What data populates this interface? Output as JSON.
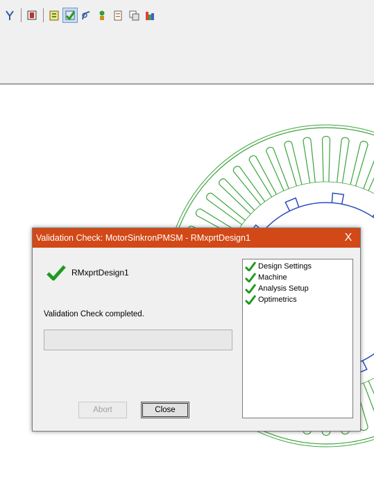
{
  "toolbar": {
    "icons": [
      "lightning-icon",
      "component-icon",
      "solution-icon",
      "validate-icon",
      "plot-icon",
      "analyze-icon",
      "report-icon",
      "copy-icon",
      "fields-icon"
    ],
    "active": "validate-icon"
  },
  "dialog": {
    "title": "Validation Check: MotorSinkronPMSM - RMxprtDesign1",
    "close_glyph": "X",
    "design_name": "RMxprtDesign1",
    "status": "Validation Check completed.",
    "progress": 0,
    "abort_label": "Abort",
    "close_label": "Close",
    "checks": [
      {
        "label": "Design Settings"
      },
      {
        "label": "Machine"
      },
      {
        "label": "Analysis Setup"
      },
      {
        "label": "Optimetrics"
      }
    ]
  },
  "colors": {
    "titlebar": "#d24817",
    "check_green": "#1f9a1f",
    "stator": "#3aa33a",
    "rotor": "#2a4bc0"
  }
}
